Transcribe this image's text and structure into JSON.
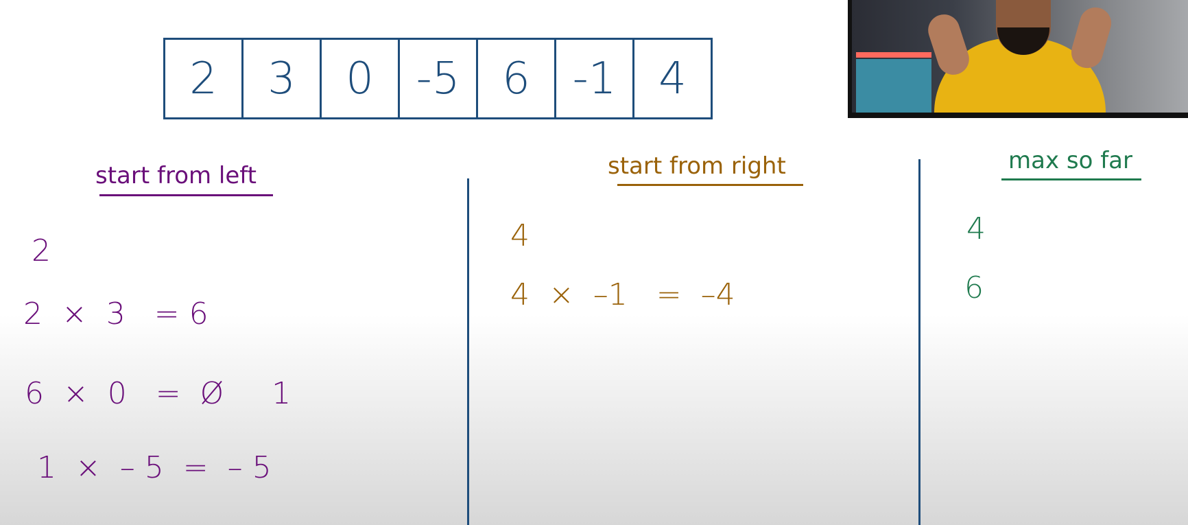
{
  "array": [
    "2",
    "3",
    "0",
    "-5",
    "6",
    "-1",
    "4"
  ],
  "columns": {
    "left": {
      "heading": "start from left",
      "lines": [
        "2",
        "2  ×  3   = 6",
        "6  ×  0   =  Ø     1",
        "1  ×  – 5  =  – 5"
      ]
    },
    "middle": {
      "heading": "start from right",
      "lines": [
        "4",
        "4  ×  –1   =  –4"
      ]
    },
    "right": {
      "heading": "max so far",
      "lines": [
        "4",
        "6"
      ]
    }
  },
  "colors": {
    "array_border": "#1e4d7b",
    "left": "#6a0f7a",
    "middle": "#9a6209",
    "right": "#1f7a4e"
  },
  "webcam": {
    "icons": [
      "person-icon"
    ]
  }
}
